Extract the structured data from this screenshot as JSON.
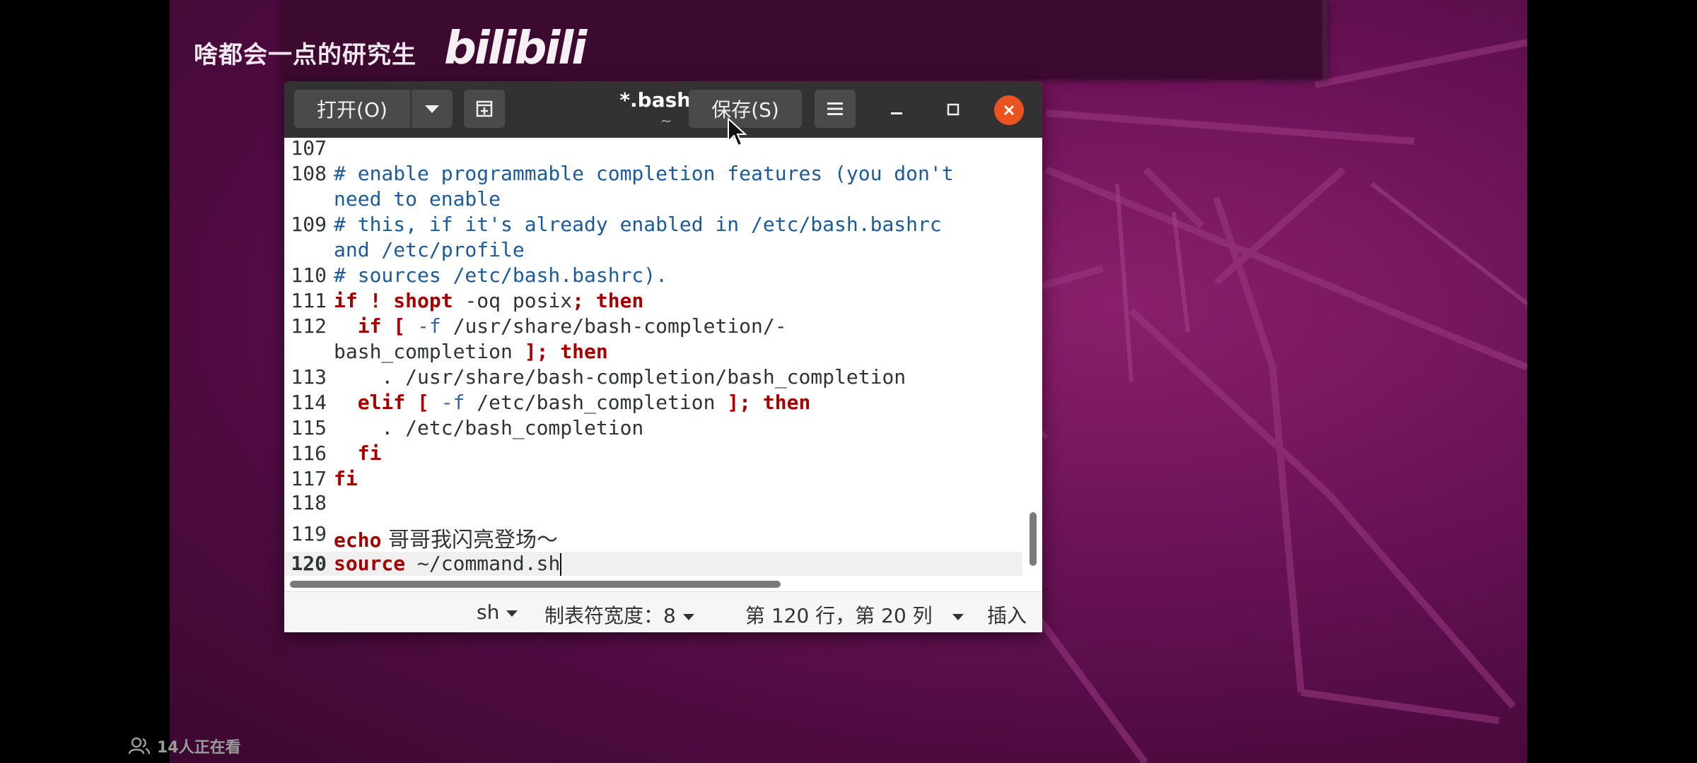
{
  "watermark": {
    "text": "啥都会一点的研究生",
    "logo": "bilibili"
  },
  "window": {
    "title": "*.bashrc",
    "subtitle": "~",
    "open_label": "打开(O)",
    "save_label": "保存(S)",
    "close_icon": "close-icon",
    "accent": "#e95420"
  },
  "editor": {
    "line_numbers": [
      "107",
      "108",
      "109",
      "110",
      "111",
      "112",
      "113",
      "114",
      "115",
      "116",
      "117",
      "118",
      "119",
      "120"
    ],
    "lines": {
      "l108a": "# enable programmable completion features (you don't",
      "l108b": "need to enable",
      "l109a": "# this, if it's already enabled in /etc/bash.bashrc",
      "l109b": "and /etc/profile",
      "l110": "# sources /etc/bash.bashrc).",
      "l111_if": "if",
      "l111_bang": "!",
      "l111_shopt": "shopt",
      "l111_rest": " -oq posix",
      "l111_then": "; then",
      "l112_if": "  if",
      "l112_br": " [",
      "l112_f": " -f",
      "l112_path": " /usr/share/bash-completion/-",
      "l112b_path": "bash_completion",
      "l112b_then": " ]; then",
      "l113": "    . /usr/share/bash-completion/bash_completion",
      "l114_elif": "  elif",
      "l114_br": " [",
      "l114_f": " -f",
      "l114_path": " /etc/bash_completion",
      "l114_then": " ]; then",
      "l115": "    . /etc/bash_completion",
      "l116": "  fi",
      "l117": "fi",
      "l119_kw": "echo",
      "l119_text": " 哥哥我闪亮登场～",
      "l120_kw": "source",
      "l120_text": " ~/command.sh"
    }
  },
  "statusbar": {
    "language": "sh",
    "tab_width": "制表符宽度：8",
    "position": "第 120 行，第 20 列",
    "mode": "插入"
  },
  "viewers": {
    "text": "14人正在看"
  }
}
